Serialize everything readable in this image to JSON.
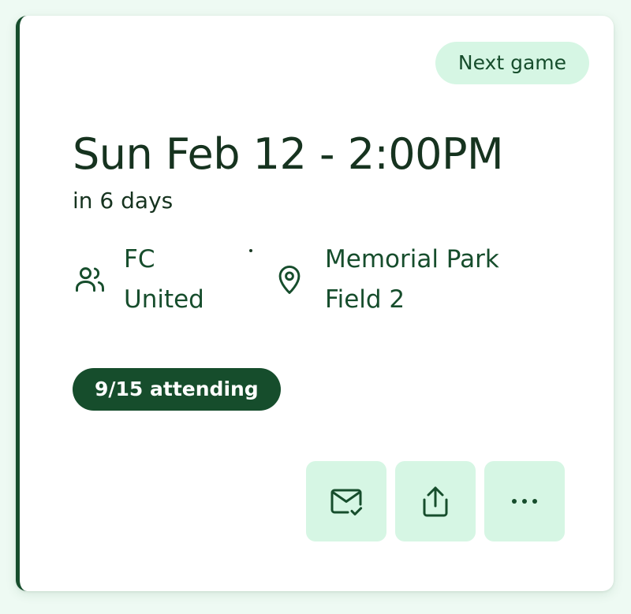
{
  "card": {
    "badge": "Next game",
    "datetime": "Sun Feb 12 - 2:00PM",
    "relative": "in 6 days",
    "team": {
      "icon": "users-icon",
      "line1": "FC",
      "line2": "United"
    },
    "location": {
      "icon": "map-pin-icon",
      "line1": "Memorial Park",
      "line2": "Field 2"
    },
    "attendance": "9/15 attending",
    "actions": [
      {
        "icon": "mail-check-icon"
      },
      {
        "icon": "share-icon"
      },
      {
        "icon": "more-horizontal-icon"
      }
    ]
  },
  "colors": {
    "accent": "#164d2c",
    "accent_soft": "#d6f6e4",
    "text_dark": "#16331f",
    "page_bg": "#eefaf3"
  }
}
